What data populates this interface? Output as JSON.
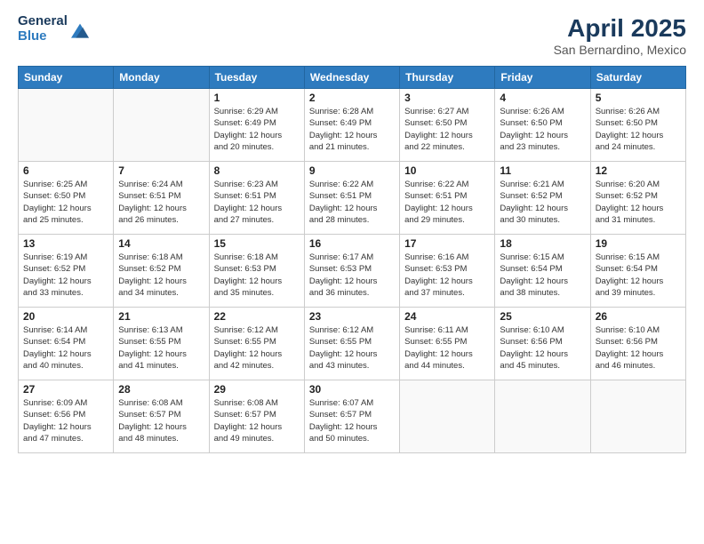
{
  "header": {
    "logo_general": "General",
    "logo_blue": "Blue",
    "month_title": "April 2025",
    "location": "San Bernardino, Mexico"
  },
  "weekdays": [
    "Sunday",
    "Monday",
    "Tuesday",
    "Wednesday",
    "Thursday",
    "Friday",
    "Saturday"
  ],
  "weeks": [
    [
      {
        "day": "",
        "info": ""
      },
      {
        "day": "",
        "info": ""
      },
      {
        "day": "1",
        "info": "Sunrise: 6:29 AM\nSunset: 6:49 PM\nDaylight: 12 hours\nand 20 minutes."
      },
      {
        "day": "2",
        "info": "Sunrise: 6:28 AM\nSunset: 6:49 PM\nDaylight: 12 hours\nand 21 minutes."
      },
      {
        "day": "3",
        "info": "Sunrise: 6:27 AM\nSunset: 6:50 PM\nDaylight: 12 hours\nand 22 minutes."
      },
      {
        "day": "4",
        "info": "Sunrise: 6:26 AM\nSunset: 6:50 PM\nDaylight: 12 hours\nand 23 minutes."
      },
      {
        "day": "5",
        "info": "Sunrise: 6:26 AM\nSunset: 6:50 PM\nDaylight: 12 hours\nand 24 minutes."
      }
    ],
    [
      {
        "day": "6",
        "info": "Sunrise: 6:25 AM\nSunset: 6:50 PM\nDaylight: 12 hours\nand 25 minutes."
      },
      {
        "day": "7",
        "info": "Sunrise: 6:24 AM\nSunset: 6:51 PM\nDaylight: 12 hours\nand 26 minutes."
      },
      {
        "day": "8",
        "info": "Sunrise: 6:23 AM\nSunset: 6:51 PM\nDaylight: 12 hours\nand 27 minutes."
      },
      {
        "day": "9",
        "info": "Sunrise: 6:22 AM\nSunset: 6:51 PM\nDaylight: 12 hours\nand 28 minutes."
      },
      {
        "day": "10",
        "info": "Sunrise: 6:22 AM\nSunset: 6:51 PM\nDaylight: 12 hours\nand 29 minutes."
      },
      {
        "day": "11",
        "info": "Sunrise: 6:21 AM\nSunset: 6:52 PM\nDaylight: 12 hours\nand 30 minutes."
      },
      {
        "day": "12",
        "info": "Sunrise: 6:20 AM\nSunset: 6:52 PM\nDaylight: 12 hours\nand 31 minutes."
      }
    ],
    [
      {
        "day": "13",
        "info": "Sunrise: 6:19 AM\nSunset: 6:52 PM\nDaylight: 12 hours\nand 33 minutes."
      },
      {
        "day": "14",
        "info": "Sunrise: 6:18 AM\nSunset: 6:52 PM\nDaylight: 12 hours\nand 34 minutes."
      },
      {
        "day": "15",
        "info": "Sunrise: 6:18 AM\nSunset: 6:53 PM\nDaylight: 12 hours\nand 35 minutes."
      },
      {
        "day": "16",
        "info": "Sunrise: 6:17 AM\nSunset: 6:53 PM\nDaylight: 12 hours\nand 36 minutes."
      },
      {
        "day": "17",
        "info": "Sunrise: 6:16 AM\nSunset: 6:53 PM\nDaylight: 12 hours\nand 37 minutes."
      },
      {
        "day": "18",
        "info": "Sunrise: 6:15 AM\nSunset: 6:54 PM\nDaylight: 12 hours\nand 38 minutes."
      },
      {
        "day": "19",
        "info": "Sunrise: 6:15 AM\nSunset: 6:54 PM\nDaylight: 12 hours\nand 39 minutes."
      }
    ],
    [
      {
        "day": "20",
        "info": "Sunrise: 6:14 AM\nSunset: 6:54 PM\nDaylight: 12 hours\nand 40 minutes."
      },
      {
        "day": "21",
        "info": "Sunrise: 6:13 AM\nSunset: 6:55 PM\nDaylight: 12 hours\nand 41 minutes."
      },
      {
        "day": "22",
        "info": "Sunrise: 6:12 AM\nSunset: 6:55 PM\nDaylight: 12 hours\nand 42 minutes."
      },
      {
        "day": "23",
        "info": "Sunrise: 6:12 AM\nSunset: 6:55 PM\nDaylight: 12 hours\nand 43 minutes."
      },
      {
        "day": "24",
        "info": "Sunrise: 6:11 AM\nSunset: 6:55 PM\nDaylight: 12 hours\nand 44 minutes."
      },
      {
        "day": "25",
        "info": "Sunrise: 6:10 AM\nSunset: 6:56 PM\nDaylight: 12 hours\nand 45 minutes."
      },
      {
        "day": "26",
        "info": "Sunrise: 6:10 AM\nSunset: 6:56 PM\nDaylight: 12 hours\nand 46 minutes."
      }
    ],
    [
      {
        "day": "27",
        "info": "Sunrise: 6:09 AM\nSunset: 6:56 PM\nDaylight: 12 hours\nand 47 minutes."
      },
      {
        "day": "28",
        "info": "Sunrise: 6:08 AM\nSunset: 6:57 PM\nDaylight: 12 hours\nand 48 minutes."
      },
      {
        "day": "29",
        "info": "Sunrise: 6:08 AM\nSunset: 6:57 PM\nDaylight: 12 hours\nand 49 minutes."
      },
      {
        "day": "30",
        "info": "Sunrise: 6:07 AM\nSunset: 6:57 PM\nDaylight: 12 hours\nand 50 minutes."
      },
      {
        "day": "",
        "info": ""
      },
      {
        "day": "",
        "info": ""
      },
      {
        "day": "",
        "info": ""
      }
    ]
  ]
}
